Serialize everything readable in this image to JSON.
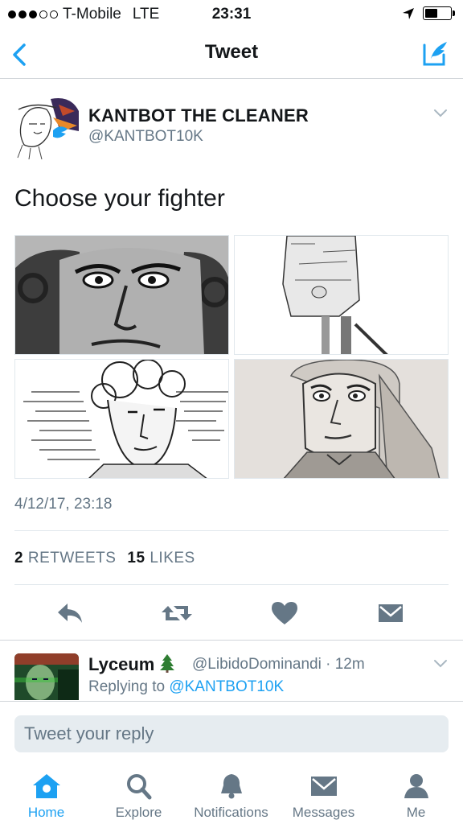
{
  "status_bar": {
    "carrier": "T-Mobile",
    "network": "LTE",
    "time": "23:31"
  },
  "nav": {
    "title": "Tweet",
    "back_icon": "chevron-left-icon",
    "compose_icon": "compose-tweet-icon"
  },
  "tweet": {
    "author_name": "KANTBOT THE CLEANER",
    "author_handle": "@KANTBOT10K",
    "text": "Choose your fighter",
    "timestamp": "4/12/17, 23:18",
    "retweets_count": "2",
    "retweets_label": "RETWEETS",
    "likes_count": "15",
    "likes_label": "LIKES",
    "media_count": 4
  },
  "actions": [
    "reply-icon",
    "retweet-icon",
    "like-icon",
    "direct-message-icon"
  ],
  "reply_tweet": {
    "name": "Lyceum",
    "handle_time": "@LibidoDominandi · 12m",
    "replying_prefix": "Replying to",
    "replying_handle": "@KANTBOT10K"
  },
  "composer": {
    "placeholder": "Tweet your reply"
  },
  "tabs": [
    {
      "label": "Home",
      "icon": "home-icon",
      "active": true
    },
    {
      "label": "Explore",
      "icon": "search-icon",
      "active": false
    },
    {
      "label": "Notifications",
      "icon": "bell-icon",
      "active": false
    },
    {
      "label": "Messages",
      "icon": "envelope-icon",
      "active": false
    },
    {
      "label": "Me",
      "icon": "person-icon",
      "active": false
    }
  ],
  "colors": {
    "accent": "#1da1f2",
    "secondary_text": "#657786",
    "primary_text": "#14171a",
    "divider": "#e1e8ed",
    "input_bg": "#e6ecf0"
  }
}
